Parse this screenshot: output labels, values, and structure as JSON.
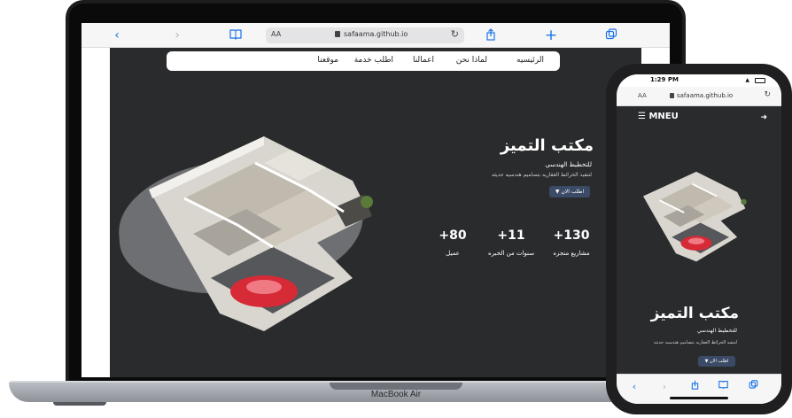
{
  "laptop": {
    "label": "MacBook Air",
    "browser": {
      "aa": "AA",
      "url": "safaama.github.io",
      "icons": [
        "back-icon",
        "forward-icon",
        "book-icon",
        "reload-icon",
        "share-icon",
        "plus-icon",
        "tabs-icon"
      ]
    },
    "site": {
      "nav": [
        "الرئيسيه",
        "لماذا نحن",
        "اعمالنا",
        "اطلب خدمة",
        "موقعنا"
      ],
      "title": "مكتب التميز",
      "subtitle": "للتخطيط الهندسي",
      "description": "لتنفيذ الخرائط العقاريه بتصاميم هندسيه حديثه",
      "button": "اطلب الان",
      "stats": [
        {
          "number": "+130",
          "label": "مشاريع منجزه"
        },
        {
          "number": "+11",
          "label": "سنوات من الخبره"
        },
        {
          "number": "+80",
          "label": "عميل"
        }
      ]
    }
  },
  "phone": {
    "status": {
      "time": "1:29 PM"
    },
    "browser": {
      "aa": "AA",
      "url": "safaama.github.io"
    },
    "site": {
      "logo": "MNEU",
      "title": "مكتب التميز",
      "subtitle": "للتخطيط الهندسي",
      "description": "لتنفيذ الخرائط العقاريه بتصاميم هندسيه حديثه",
      "button": "اطلب الان"
    }
  },
  "colors": {
    "site_bg": "#2a2b2d",
    "button": "#3b4a66",
    "safari_accent": "#1a73e8",
    "car": "#d62a36"
  }
}
